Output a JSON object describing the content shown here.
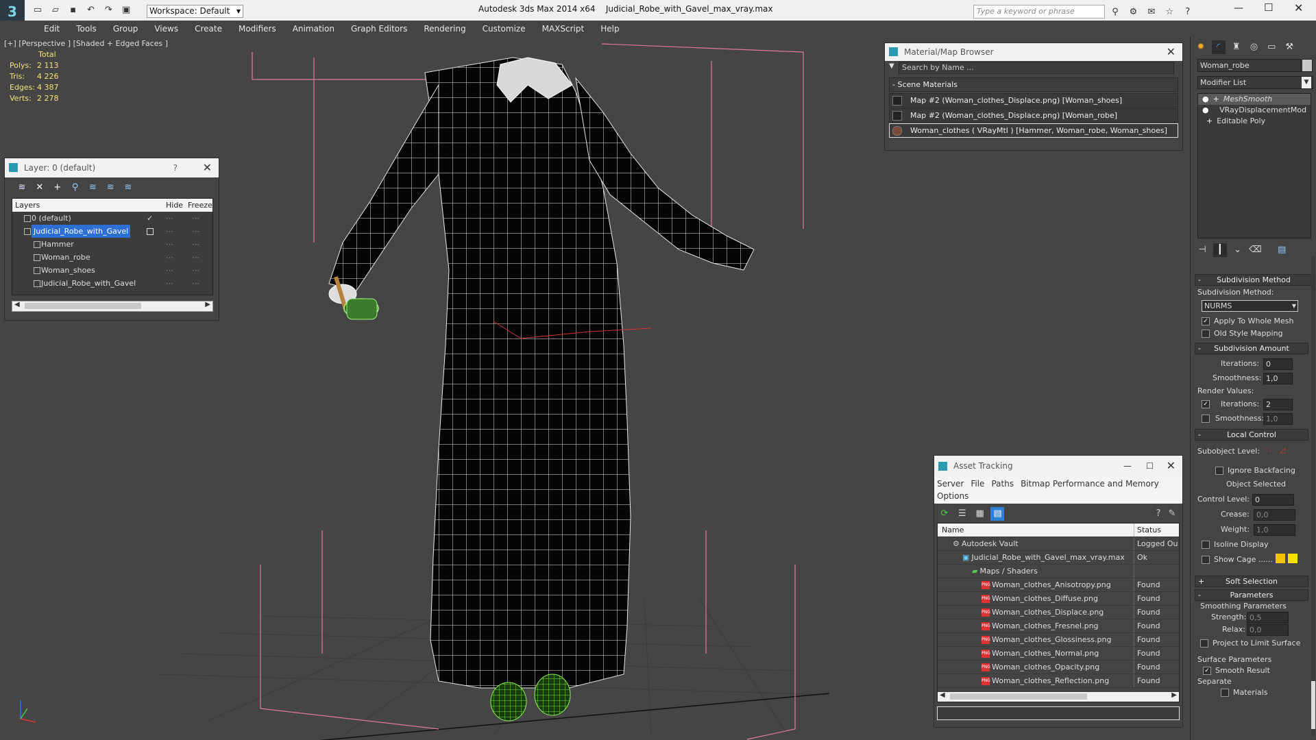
{
  "app": {
    "title": "Autodesk 3ds Max  2014 x64",
    "filename": "Judicial_Robe_with_Gavel_max_vray.max",
    "workspace": "Workspace: Default",
    "search_placeholder": "Type a keyword or phrase"
  },
  "menu": [
    "Edit",
    "Tools",
    "Group",
    "Views",
    "Create",
    "Modifiers",
    "Animation",
    "Graph Editors",
    "Rendering",
    "Customize",
    "MAXScript",
    "Help"
  ],
  "viewport": {
    "label": "[+] [Perspective ] [Shaded + Edged Faces ]",
    "stats_header": "Total",
    "stats": [
      {
        "label": "Polys:",
        "value": "2 113"
      },
      {
        "label": "Tris:",
        "value": "4 226"
      },
      {
        "label": "Edges:",
        "value": "4 387"
      },
      {
        "label": "Verts:",
        "value": "2 278"
      }
    ]
  },
  "layer_panel": {
    "title": "Layer: 0 (default)",
    "help": "?",
    "columns": {
      "layers": "Layers",
      "hide": "Hide",
      "freeze": "Freeze"
    },
    "rows": [
      {
        "name": "0 (default)",
        "indent": 1,
        "selected": false
      },
      {
        "name": "Judicial_Robe_with_Gavel",
        "indent": 1,
        "selected": true
      },
      {
        "name": "Hammer",
        "indent": 2,
        "selected": false
      },
      {
        "name": "Woman_robe",
        "indent": 2,
        "selected": false
      },
      {
        "name": "Woman_shoes",
        "indent": 2,
        "selected": false
      },
      {
        "name": "Judicial_Robe_with_Gavel",
        "indent": 2,
        "selected": false
      }
    ]
  },
  "material_browser": {
    "title": "Material/Map Browser",
    "search_placeholder": "Search by Name ...",
    "section": "Scene Materials",
    "items": [
      "Map #2 (Woman_clothes_Displace.png) [Woman_shoes]",
      "Map #2 (Woman_clothes_Displace.png) [Woman_robe]",
      "Woman_clothes  ( VRayMtl ) [Hammer, Woman_robe, Woman_shoes]"
    ]
  },
  "asset_tracking": {
    "title": "Asset Tracking",
    "menu": [
      "Server",
      "File",
      "Paths",
      "Bitmap Performance and Memory",
      "Options"
    ],
    "columns": {
      "name": "Name",
      "status": "Status"
    },
    "rows": [
      {
        "name": "Autodesk Vault",
        "status": "Logged Ou",
        "indent": 1,
        "kind": "vault"
      },
      {
        "name": "Judicial_Robe_with_Gavel_max_vray.max",
        "status": "Ok",
        "indent": 2,
        "kind": "max"
      },
      {
        "name": "Maps / Shaders",
        "status": "",
        "indent": 3,
        "kind": "folder"
      },
      {
        "name": "Woman_clothes_Anisotropy.png",
        "status": "Found",
        "indent": 4,
        "kind": "png"
      },
      {
        "name": "Woman_clothes_Diffuse.png",
        "status": "Found",
        "indent": 4,
        "kind": "png"
      },
      {
        "name": "Woman_clothes_Displace.png",
        "status": "Found",
        "indent": 4,
        "kind": "png"
      },
      {
        "name": "Woman_clothes_Fresnel.png",
        "status": "Found",
        "indent": 4,
        "kind": "png"
      },
      {
        "name": "Woman_clothes_Glossiness.png",
        "status": "Found",
        "indent": 4,
        "kind": "png"
      },
      {
        "name": "Woman_clothes_Normal.png",
        "status": "Found",
        "indent": 4,
        "kind": "png"
      },
      {
        "name": "Woman_clothes_Opacity.png",
        "status": "Found",
        "indent": 4,
        "kind": "png"
      },
      {
        "name": "Woman_clothes_Reflection.png",
        "status": "Found",
        "indent": 4,
        "kind": "png"
      }
    ]
  },
  "command_panel": {
    "object_name": "Woman_robe",
    "modifier_list": "Modifier List",
    "stack": [
      "MeshSmooth",
      "VRayDisplacementMod",
      "Editable Poly"
    ],
    "subdivision_method_rollout": "Subdivision Method",
    "subdivision_method_label": "Subdivision Method:",
    "subdivision_method_value": "NURMS",
    "apply_whole_mesh": "Apply To Whole Mesh",
    "old_style_mapping": "Old Style Mapping",
    "subdivision_amount_rollout": "Subdivision Amount",
    "iterations_label": "Iterations:",
    "iterations_value": "0",
    "smoothness_label": "Smoothness:",
    "smoothness_value": "1,0",
    "render_values_label": "Render Values:",
    "render_iterations_label": "Iterations:",
    "render_iterations_value": "2",
    "render_smoothness_label": "Smoothness:",
    "render_smoothness_value": "1,0",
    "local_control_rollout": "Local Control",
    "subobject_level_label": "Subobject Level:",
    "ignore_backfacing": "Ignore Backfacing",
    "object_selected": "Object Selected",
    "control_level_label": "Control Level:",
    "control_level_value": "0",
    "crease_label": "Crease:",
    "crease_value": "0,0",
    "weight_label": "Weight:",
    "weight_value": "1,0",
    "isoline_display": "Isoline Display",
    "show_cage": "Show Cage ......",
    "soft_selection_rollout": "Soft Selection",
    "parameters_rollout": "Parameters",
    "smoothing_parameters": "Smoothing Parameters",
    "strength_label": "Strength:",
    "strength_value": "0,5",
    "relax_label": "Relax:",
    "relax_value": "0,0",
    "project_limit": "Project to Limit Surface",
    "surface_parameters": "Surface Parameters",
    "smooth_result": "Smooth Result",
    "separate": "Separate",
    "materials": "Materials"
  }
}
